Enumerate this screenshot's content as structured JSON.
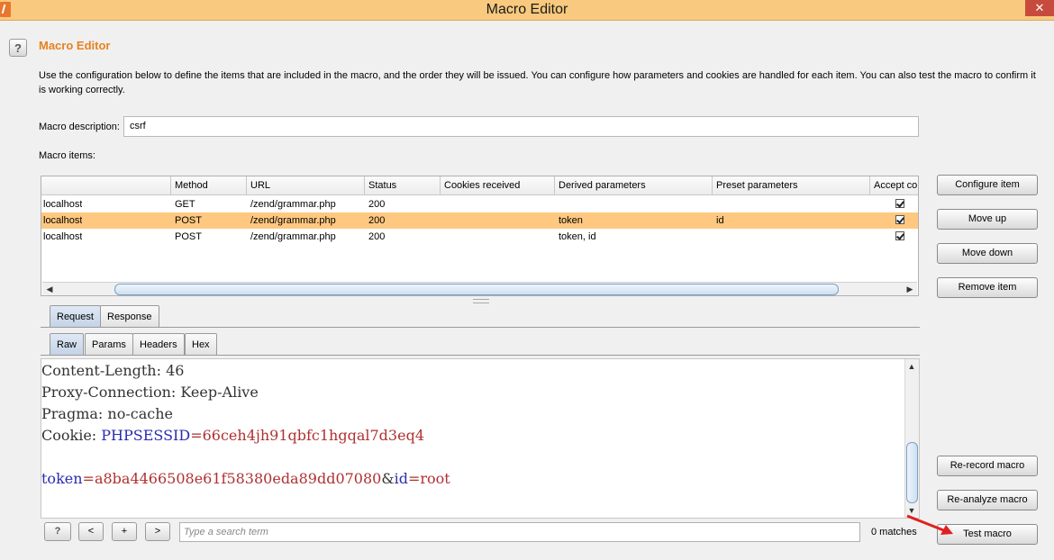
{
  "window": {
    "title": "Macro Editor",
    "close_label": "✕"
  },
  "header": {
    "help_label": "?",
    "title": "Macro Editor",
    "description": "Use the configuration below to define the items that are included in the macro, and the order they will be issued. You can configure how parameters and cookies are handled for each item. You can also test the macro to confirm it is working correctly."
  },
  "macro": {
    "description_label": "Macro description:",
    "description_value": "csrf",
    "items_label": "Macro items:"
  },
  "table": {
    "columns": [
      "",
      "Method",
      "URL",
      "Status",
      "Cookies received",
      "Derived parameters",
      "Preset parameters",
      "Accept co"
    ],
    "rows": [
      {
        "host": "localhost",
        "method": "GET",
        "url": "/zend/grammar.php",
        "status": "200",
        "cookies": "",
        "derived": "",
        "preset": "",
        "accept": true,
        "selected": false
      },
      {
        "host": "localhost",
        "method": "POST",
        "url": "/zend/grammar.php",
        "status": "200",
        "cookies": "",
        "derived": "token",
        "preset": "id",
        "accept": true,
        "selected": true
      },
      {
        "host": "localhost",
        "method": "POST",
        "url": "/zend/grammar.php",
        "status": "200",
        "cookies": "",
        "derived": "token, id",
        "preset": "",
        "accept": true,
        "selected": false
      }
    ]
  },
  "item_buttons": {
    "configure": "Configure item",
    "move_up": "Move up",
    "move_down": "Move down",
    "remove": "Remove item"
  },
  "tabs": {
    "request": "Request",
    "response": "Response"
  },
  "subtabs": {
    "raw": "Raw",
    "params": "Params",
    "headers": "Headers",
    "hex": "Hex"
  },
  "editor": {
    "line1": {
      "key": "Content-Length",
      "sep": ": ",
      "value": "46"
    },
    "line2": {
      "key": "Proxy-Connection",
      "sep": ": ",
      "value": "Keep-Alive"
    },
    "line3": {
      "key": "Pragma",
      "sep": ": ",
      "value": "no-cache"
    },
    "line4": {
      "key": "Cookie",
      "sep": ": ",
      "cookie_name": "PHPSESSID",
      "eq": "=",
      "cookie_value": "66ceh4jh91qbfc1hgqal7d3eq4"
    },
    "body": {
      "k1": "token",
      "eq1": "=",
      "v1": "a8ba4466508e61f58380eda89dd07080",
      "amp": "&",
      "k2": "id",
      "eq2": "=",
      "v2": "root"
    }
  },
  "search": {
    "help": "?",
    "prev": "<",
    "add": "+",
    "next": ">",
    "placeholder": "Type a search term",
    "matches": "0 matches"
  },
  "macro_buttons": {
    "rerecord": "Re-record macro",
    "reanalyze": "Re-analyze macro",
    "test": "Test macro"
  },
  "colors": {
    "accent": "#e8821e",
    "selected_row": "#ffc880",
    "titlebar": "#f8c97e",
    "annotation_arrow": "#e02020"
  }
}
